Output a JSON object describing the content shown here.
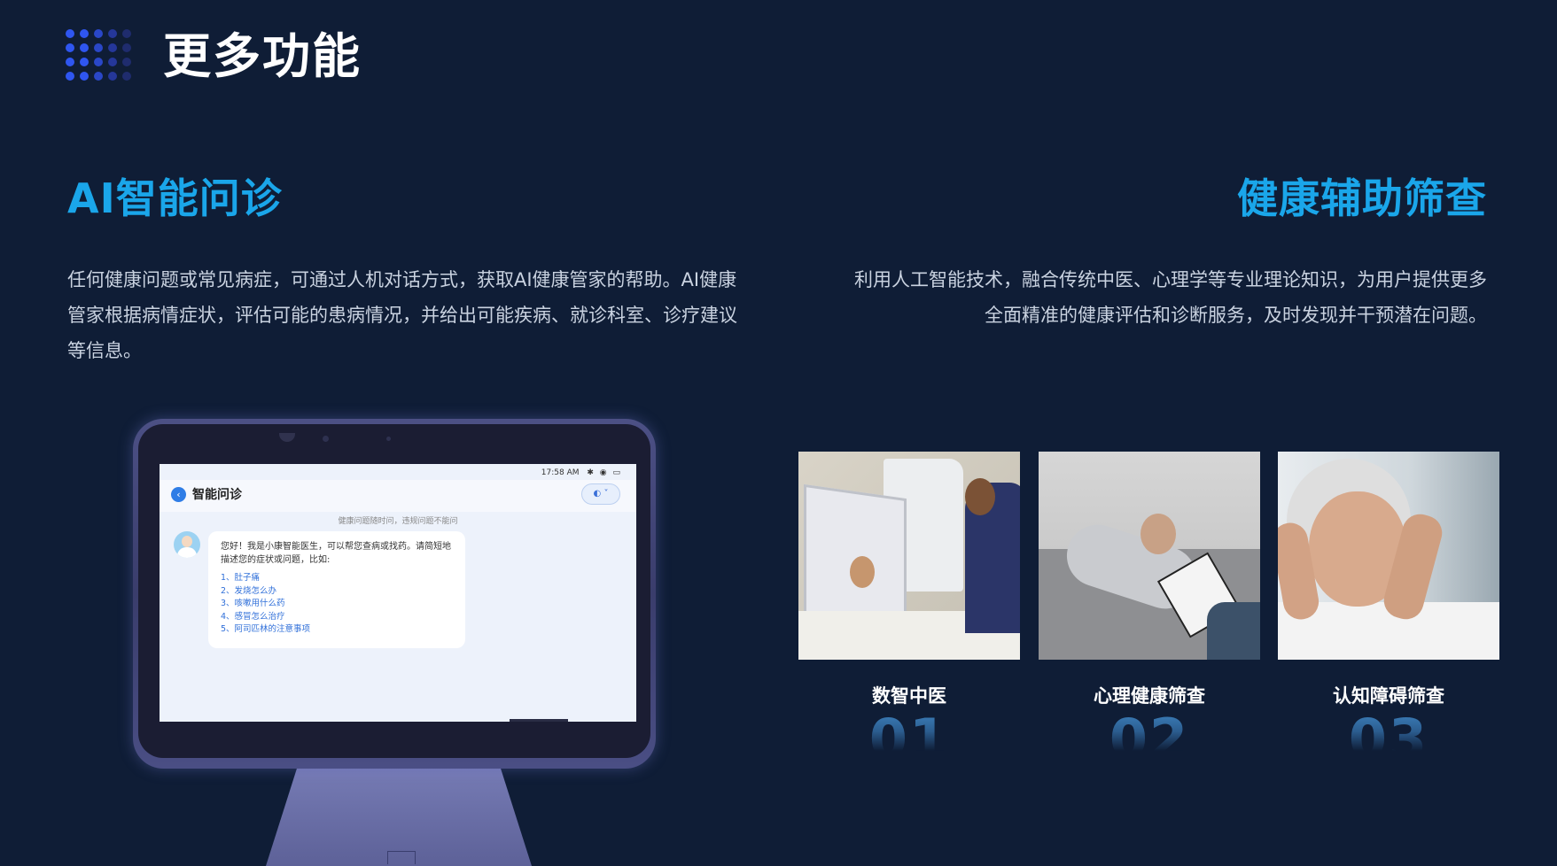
{
  "header": {
    "title": "更多功能"
  },
  "left": {
    "title": "AI智能问诊",
    "description": "任何健康问题或常见病症，可通过人机对话方式，获取AI健康管家的帮助。AI健康管家根据病情症状，评估可能的患病情况，并给出可能疾病、就诊科室、诊疗建议等信息。"
  },
  "right": {
    "title": "健康辅助筛查",
    "description_line1": "利用人工智能技术，融合传统中医、心理学等专业理论知识，为用户提供更多",
    "description_line2": "全面精准的健康评估和诊断服务，及时发现并干预潜在问题。"
  },
  "device_screen": {
    "time": "17:58 AM",
    "status_icons": "✱ ◉ ▭",
    "back_icon": "‹",
    "title": "智能问诊",
    "mode_label": "◐ ˅",
    "notice": "健康问题随时问，违规问题不能问",
    "greeting": "您好！我是小康智能医生，可以帮您查病或找药。请简短地描述您的症状或问题，比如:",
    "suggestions": [
      "1、肚子痛",
      "2、发烧怎么办",
      "3、咳嗽用什么药",
      "4、感冒怎么治疗",
      "5、阿司匹林的注意事项"
    ]
  },
  "cards": [
    {
      "label": "数智中医",
      "number": "01"
    },
    {
      "label": "心理健康筛查",
      "number": "02"
    },
    {
      "label": "认知障碍筛查",
      "number": "03"
    }
  ],
  "colors": {
    "background": "#0f1d36",
    "accent": "#1aa6ea",
    "number_gradient": "#3f86c4"
  }
}
